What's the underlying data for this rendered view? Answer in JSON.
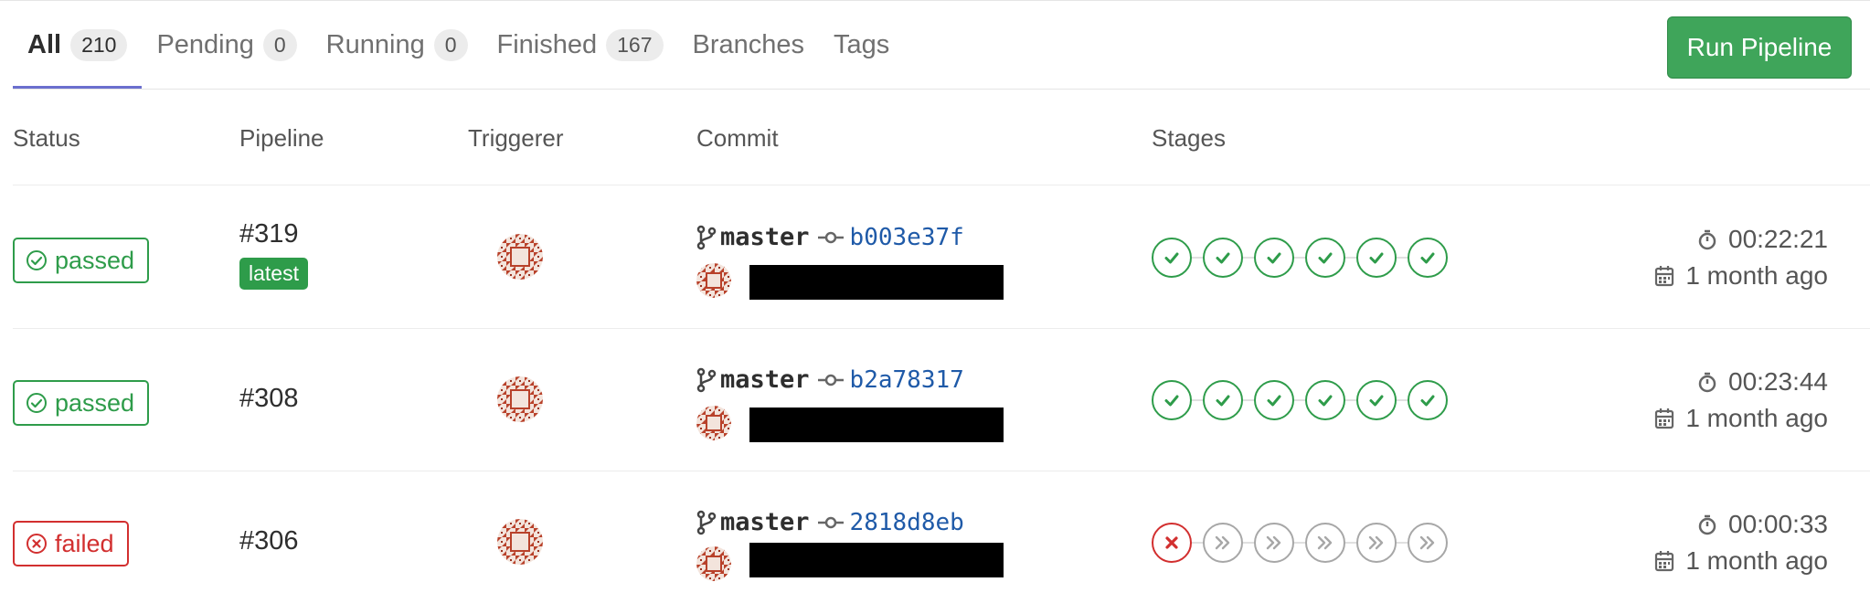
{
  "tabs": [
    {
      "label": "All",
      "count": "210"
    },
    {
      "label": "Pending",
      "count": "0"
    },
    {
      "label": "Running",
      "count": "0"
    },
    {
      "label": "Finished",
      "count": "167"
    },
    {
      "label": "Branches"
    },
    {
      "label": "Tags"
    }
  ],
  "run_pipeline_label": "Run Pipeline",
  "columns": {
    "status": "Status",
    "pipeline": "Pipeline",
    "triggerer": "Triggerer",
    "commit": "Commit",
    "stages": "Stages"
  },
  "rows": [
    {
      "status": "passed",
      "pipeline_id": "#319",
      "badge": "latest",
      "branch": "master",
      "sha": "b003e37f",
      "stages": [
        "success",
        "success",
        "success",
        "success",
        "success",
        "success"
      ],
      "duration": "00:22:21",
      "finished": "1 month ago"
    },
    {
      "status": "passed",
      "pipeline_id": "#308",
      "branch": "master",
      "sha": "b2a78317",
      "stages": [
        "success",
        "success",
        "success",
        "success",
        "success",
        "success"
      ],
      "duration": "00:23:44",
      "finished": "1 month ago"
    },
    {
      "status": "failed",
      "pipeline_id": "#306",
      "branch": "master",
      "sha": "2818d8eb",
      "stages": [
        "failed",
        "skipped",
        "skipped",
        "skipped",
        "skipped",
        "skipped"
      ],
      "duration": "00:00:33",
      "finished": "1 month ago"
    }
  ],
  "colors": {
    "success": "#2e9c4a",
    "failed": "#d22f2f",
    "skipped": "#a7a7a7",
    "active_tab": "#6b6fce",
    "sha_link": "#1f5aa8"
  },
  "icons": {
    "passed": "check-circle-icon",
    "failed": "x-circle-icon",
    "branch": "branch-icon",
    "commit": "commit-icon",
    "duration": "timer-icon",
    "finished": "calendar-icon",
    "skipped_stage": "double-chevron-icon"
  }
}
